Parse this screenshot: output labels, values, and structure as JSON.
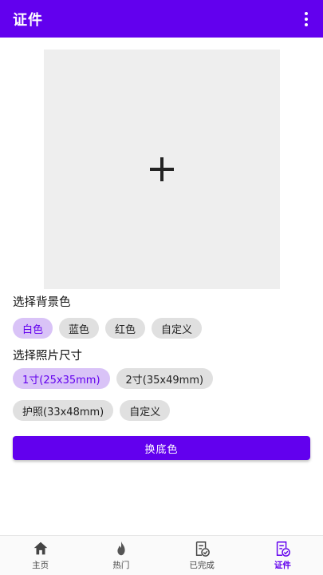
{
  "app_bar": {
    "title": "证件",
    "more_icon": "more-vert-icon"
  },
  "photo": {
    "icon": "plus-icon"
  },
  "background": {
    "title": "选择背景色",
    "options": [
      "白色",
      "蓝色",
      "红色",
      "自定义"
    ],
    "selected": "白色"
  },
  "size": {
    "title": "选择照片尺寸",
    "options": [
      "1寸(25x35mm)",
      "2寸(35x49mm)",
      "护照(33x48mm)",
      "自定义"
    ],
    "selected": "1寸(25x35mm)"
  },
  "action": {
    "label": "换底色"
  },
  "nav": {
    "items": [
      {
        "label": "主页",
        "icon": "home-icon"
      },
      {
        "label": "热门",
        "icon": "fire-icon"
      },
      {
        "label": "已完成",
        "icon": "completed-doc-icon"
      },
      {
        "label": "证件",
        "icon": "id-doc-icon"
      }
    ],
    "active": "证件"
  },
  "colors": {
    "primary": "#6200ee",
    "chip": "#e0e0e0",
    "chip_selected": "#d9c3f7",
    "photo_bg": "#eeeeee"
  }
}
